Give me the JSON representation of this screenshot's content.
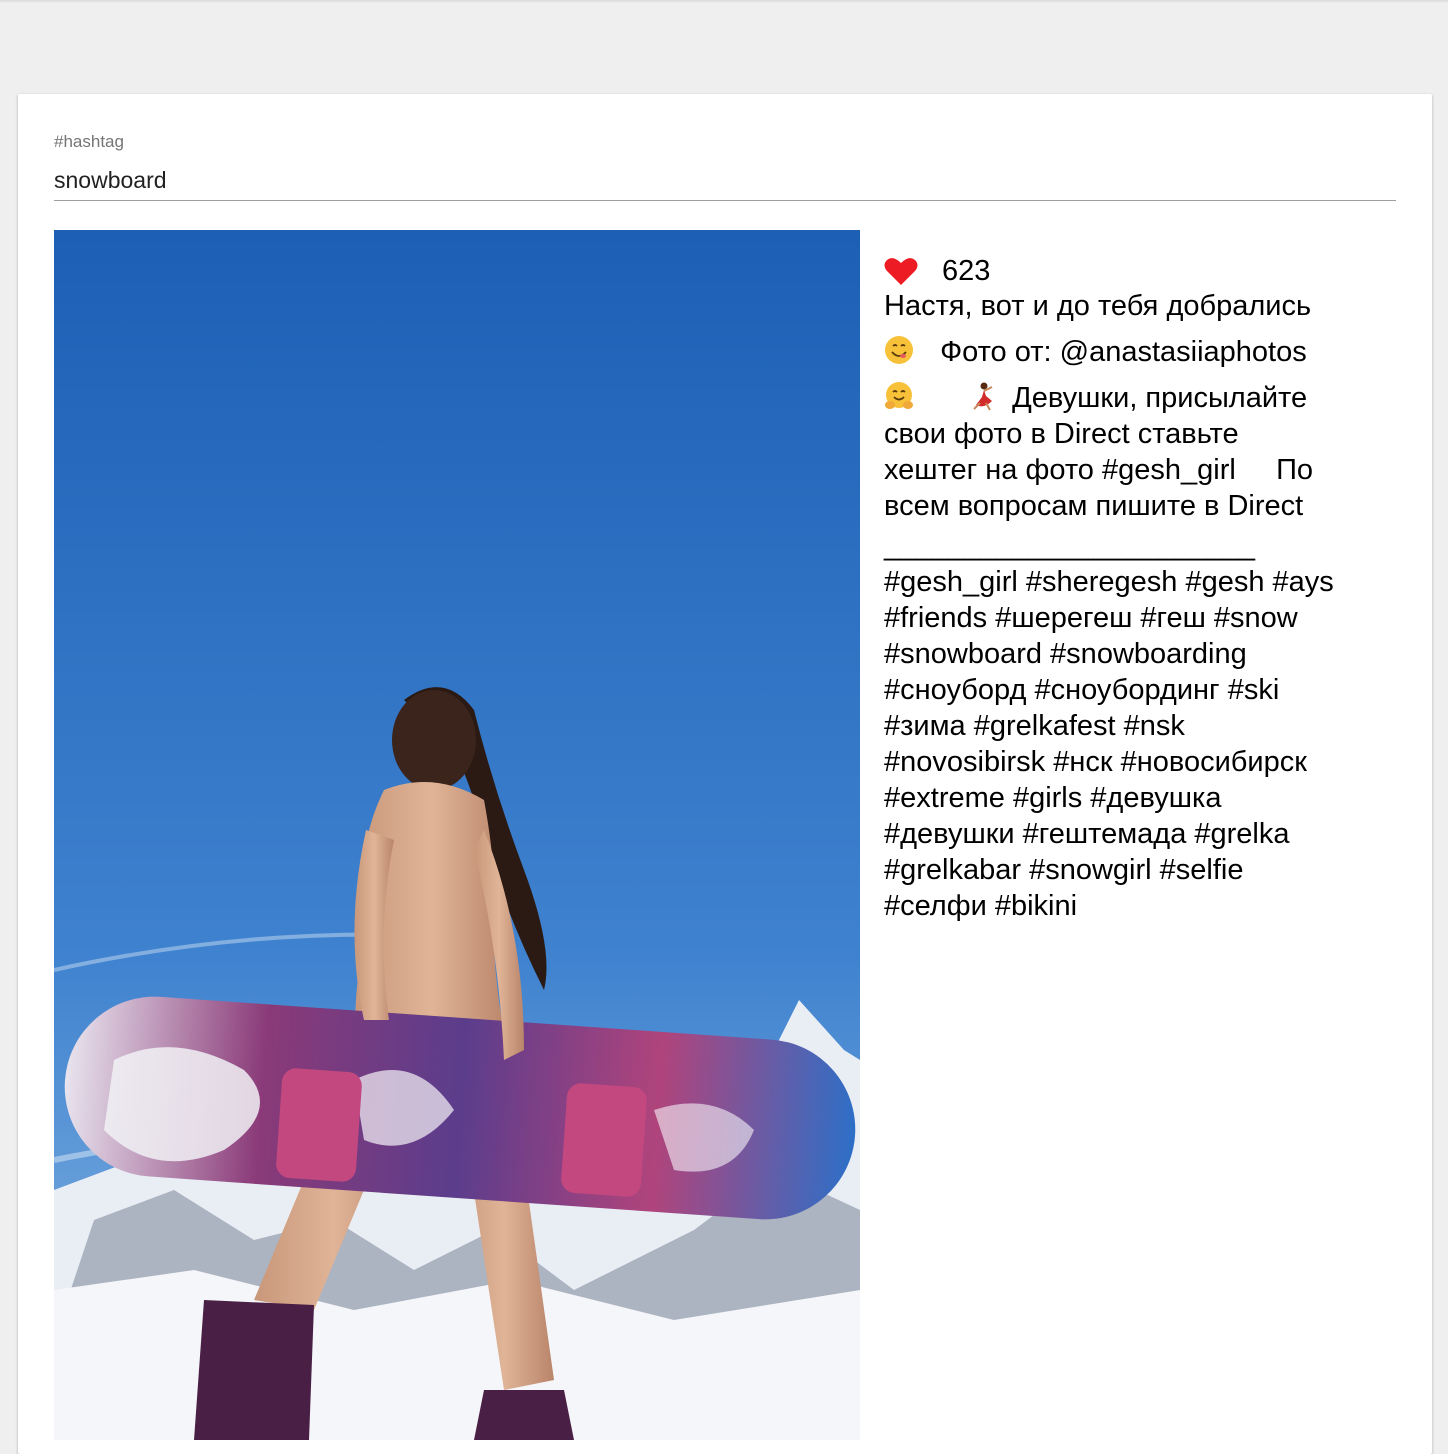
{
  "search": {
    "label": "#hashtag",
    "value": "snowboard"
  },
  "post": {
    "image_alt": "snowboard",
    "likes": "623",
    "caption_line1": "Настя, вот и до тебя добрались",
    "caption_line2": "Фото от: @anastasiiaphotos",
    "caption_line3": "Девушки, присылайте",
    "caption_block1": "свои фото в Direct ставьте\nхештег на фото #gesh_girl     По\nвсем вопросам пишите в Direct",
    "divider": "_______________________",
    "hashtags": "#gesh_girl #sheregesh #gesh #ays\n#friends #шерегеш #геш #snow\n#snowboard #snowboarding\n#сноуборд #сноубординг #ski\n#зима #grelkafest #nsk\n#novosibirsk #нск #новосибирск\n#extreme #girls #девушка\n#девушки #гештемада #grelka\n#grelkabar #snowgirl #selfie\n#селфи #bikini",
    "icons": [
      "heart-icon",
      "smiling-face-emoji-icon",
      "hugging-face-emoji-icon",
      "dancer-emoji-icon"
    ],
    "colors": {
      "heart": "#ed1c24",
      "sky_top": "#1e63b8",
      "sky_bottom": "#7fb0e0",
      "underline": "#9e9e9e"
    }
  }
}
